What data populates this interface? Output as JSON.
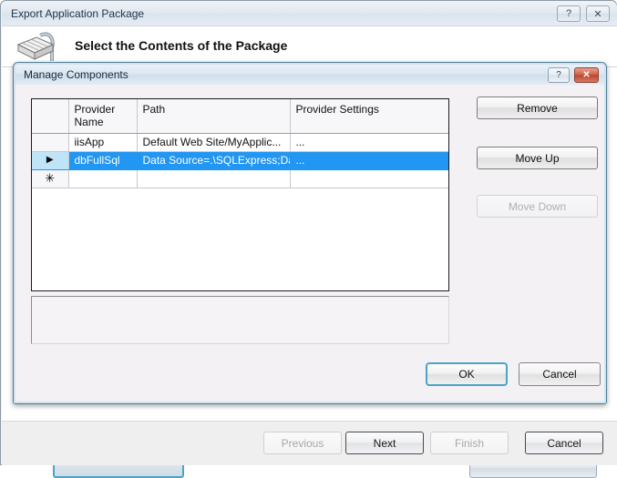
{
  "wizard": {
    "title": "Export Application Package",
    "heading": "Select the Contents of the Package",
    "help_label": "?",
    "close_label": "✕",
    "icon": "package-icon",
    "footer": {
      "previous": "Previous",
      "next": "Next",
      "finish": "Finish",
      "cancel": "Cancel"
    }
  },
  "dialog": {
    "title": "Manage Components",
    "help_label": "?",
    "close_label": "✕",
    "grid": {
      "columns": [
        "",
        "Provider Name",
        "Path",
        "Provider Settings"
      ],
      "rows": [
        {
          "indicator": "",
          "provider_name": "iisApp",
          "path": "Default Web Site/MyApplic...",
          "provider_settings": "...",
          "selected": false
        },
        {
          "indicator": "▶",
          "provider_name": "dbFullSql",
          "path": "Data Source=.\\SQLExpress;Dat",
          "provider_settings": "...",
          "selected": true
        },
        {
          "indicator": "✳",
          "provider_name": "",
          "path": "",
          "provider_settings": "",
          "selected": false
        }
      ]
    },
    "side_buttons": {
      "remove": "Remove",
      "move_up": "Move Up",
      "move_down": "Move Down"
    },
    "footer": {
      "ok": "OK",
      "cancel": "Cancel"
    }
  },
  "colors": {
    "selection_blue": "#2196f3",
    "row_header_blue": "#bfe4f8",
    "close_red": "#b9472f",
    "focus_border": "#4ba3c7"
  }
}
